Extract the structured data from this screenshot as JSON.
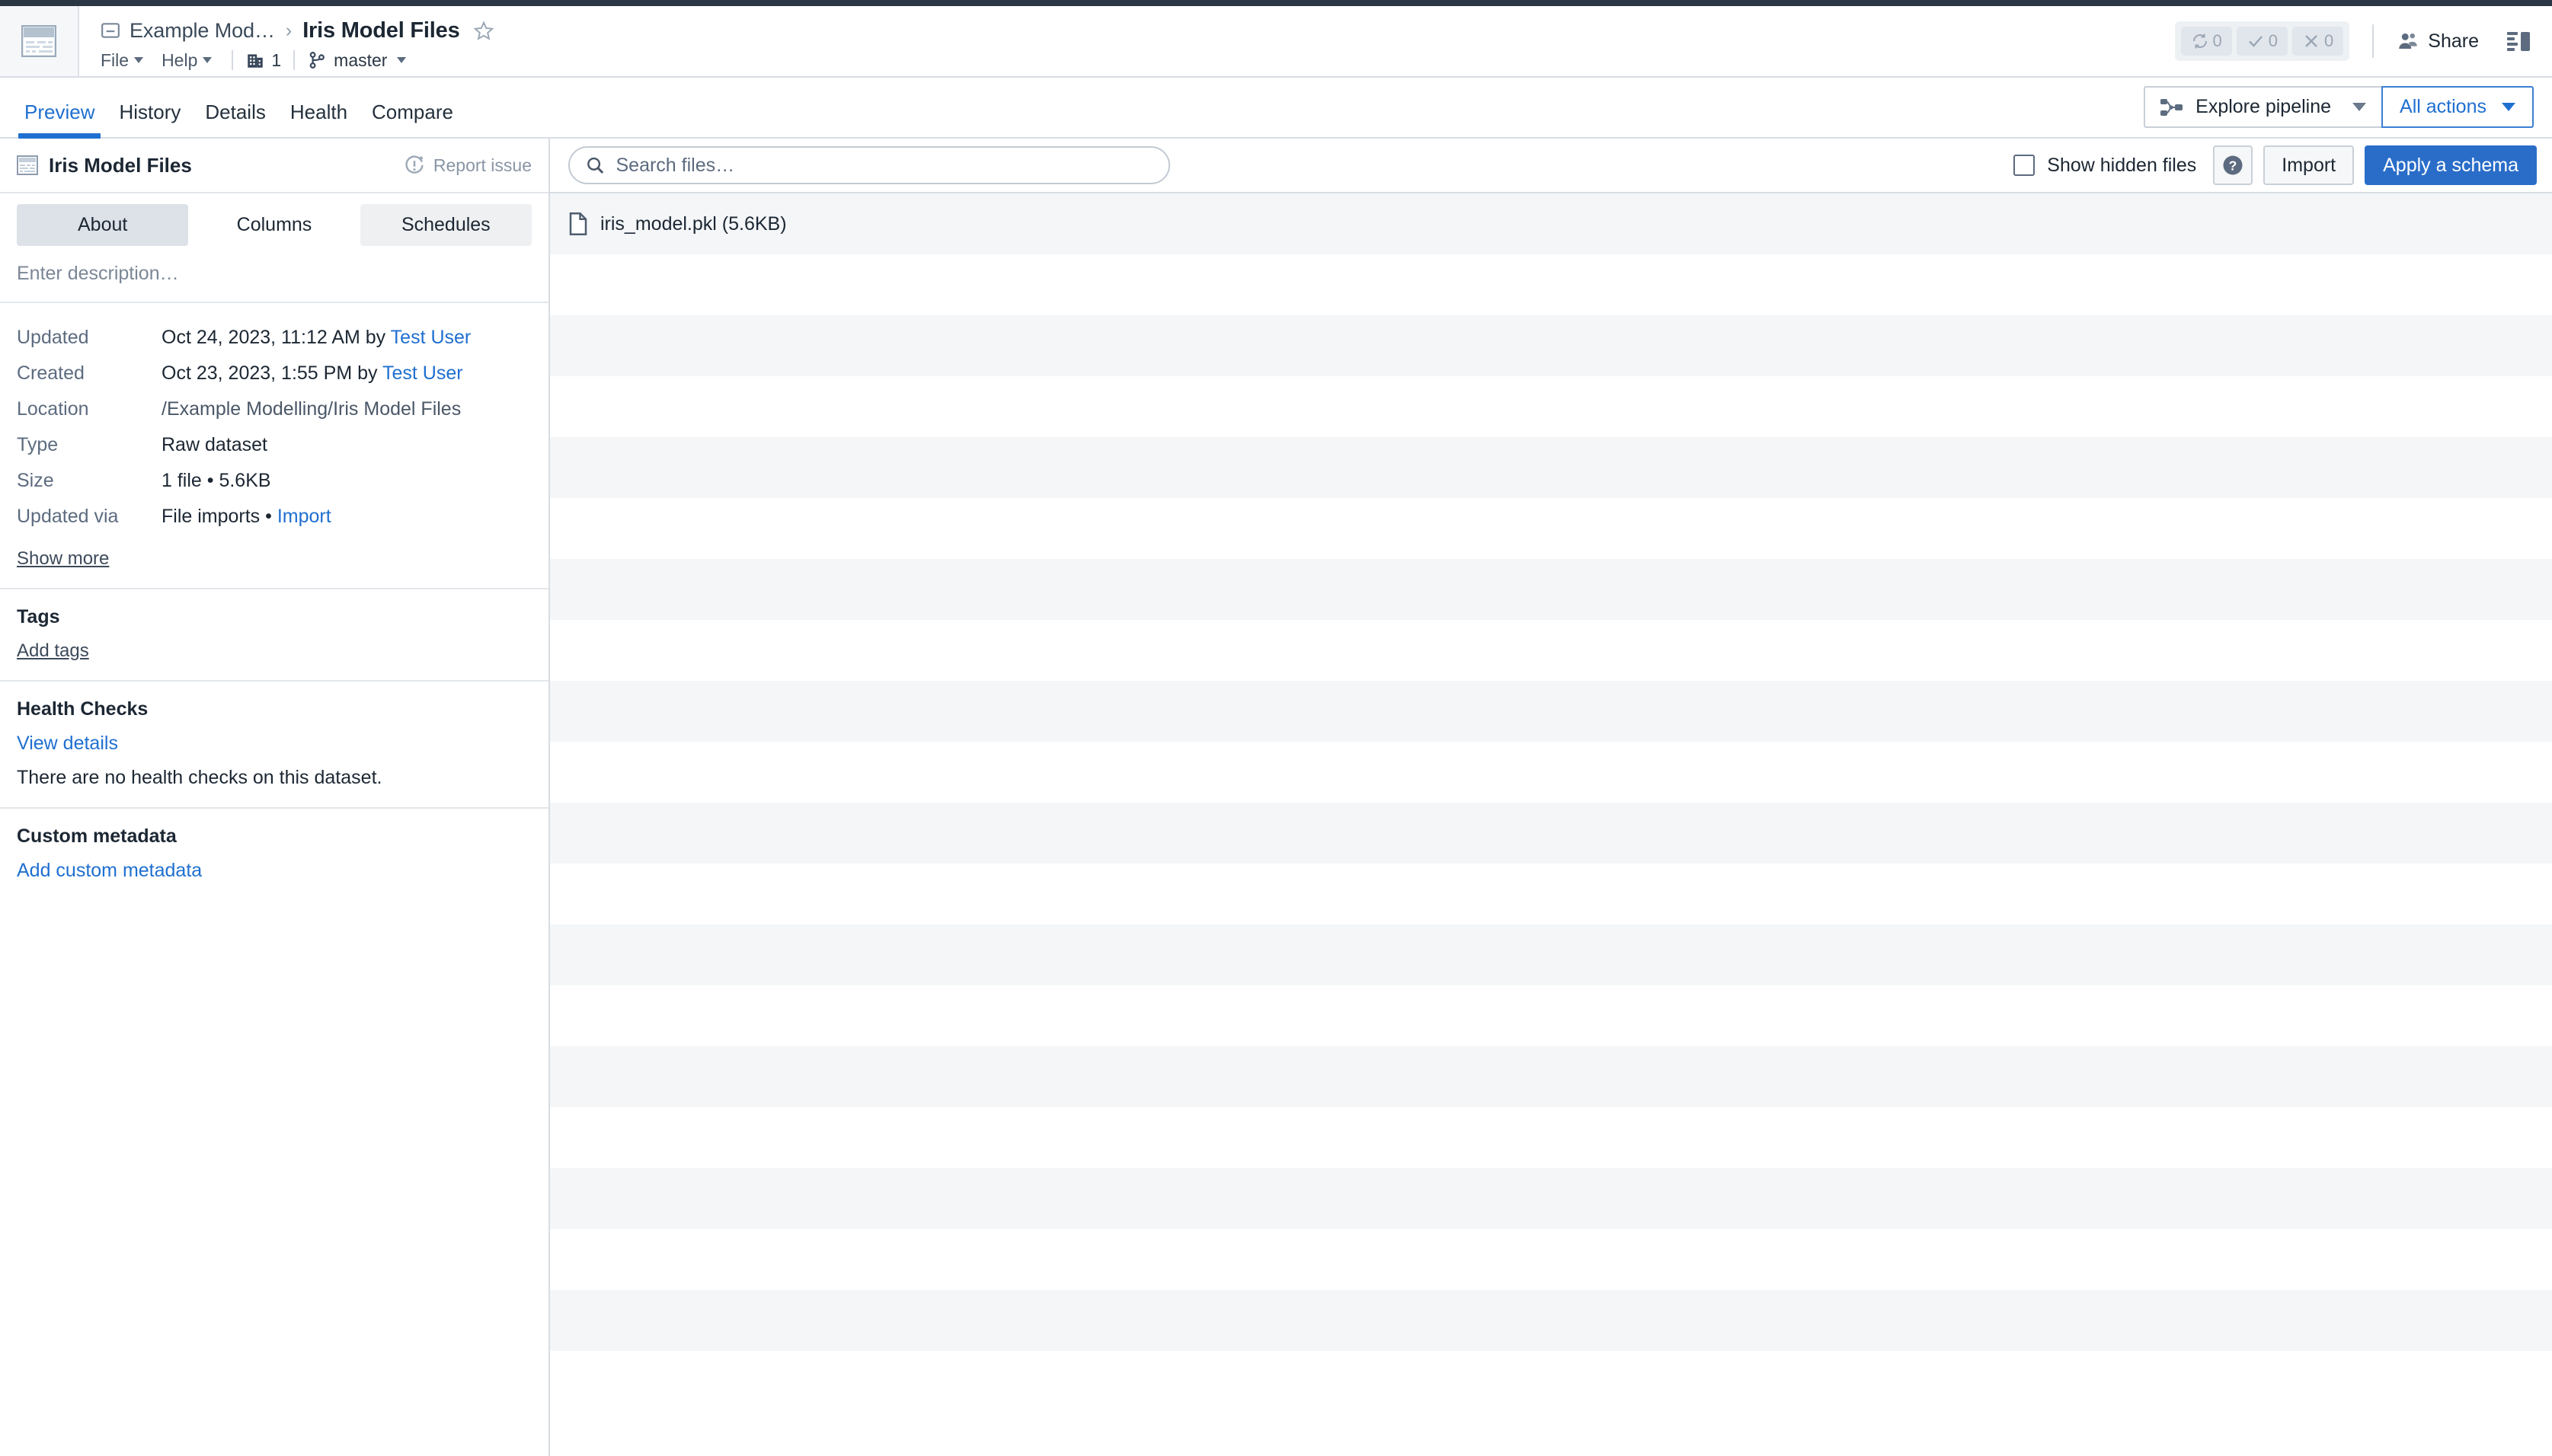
{
  "header": {
    "app_icon": "dataset-icon",
    "breadcrumb": {
      "parent_icon": "folder-icon",
      "parent": "Example Mod…",
      "separator": "›",
      "current": "Iris Model Files",
      "favorite_icon": "star-icon"
    },
    "menus": [
      {
        "label": "File",
        "icon": "chevron-down-icon"
      },
      {
        "label": "Help",
        "icon": "chevron-down-icon"
      }
    ],
    "org_count": "1",
    "org_icon": "organization-icon",
    "branch": "master",
    "branch_icon": "branch-icon",
    "status": {
      "builds_icon": "sync-icon",
      "builds_count": "0",
      "success_icon": "check-icon",
      "success_count": "0",
      "failed_icon": "cross-icon",
      "failed_count": "0"
    },
    "share_label": "Share",
    "share_icon": "people-icon",
    "layout_icon": "panel-layout-icon"
  },
  "tabs": [
    {
      "label": "Preview",
      "active": true
    },
    {
      "label": "History",
      "active": false
    },
    {
      "label": "Details",
      "active": false
    },
    {
      "label": "Health",
      "active": false
    },
    {
      "label": "Compare",
      "active": false
    }
  ],
  "tab_actions": {
    "explore_pipeline": "Explore pipeline",
    "explore_icon": "pipeline-icon",
    "all_actions": "All actions"
  },
  "sidebar": {
    "title": "Iris Model Files",
    "title_icon": "dataset-icon",
    "report_issue": "Report issue",
    "report_icon": "alert-circle-icon",
    "segments": [
      {
        "label": "About",
        "state": "active"
      },
      {
        "label": "Columns",
        "state": "default"
      },
      {
        "label": "Schedules",
        "state": "alt"
      }
    ],
    "description_placeholder": "Enter description…",
    "metadata": [
      {
        "key": "Updated",
        "value": "Oct 24, 2023, 11:12 AM by ",
        "link": "Test User"
      },
      {
        "key": "Created",
        "value": "Oct 23, 2023, 1:55 PM by ",
        "link": "Test User"
      },
      {
        "key": "Location",
        "value": "/Example Modelling/Iris Model Files",
        "link": ""
      },
      {
        "key": "Type",
        "value": "Raw dataset",
        "link": ""
      },
      {
        "key": "Size",
        "value": "1 file • 5.6KB",
        "link": ""
      },
      {
        "key": "Updated via",
        "value": "File imports • ",
        "link": "Import"
      }
    ],
    "show_more": "Show more",
    "tags": {
      "heading": "Tags",
      "add_label": "Add tags"
    },
    "health": {
      "heading": "Health Checks",
      "view_details": "View details",
      "empty_message": "There are no health checks on this dataset."
    },
    "custom_metadata": {
      "heading": "Custom metadata",
      "add_label": "Add custom metadata"
    }
  },
  "content": {
    "search_placeholder": "Search files…",
    "search_value": "",
    "search_icon": "search-icon",
    "show_hidden_label": "Show hidden files",
    "show_hidden_checked": false,
    "help_icon": "help-icon",
    "import_label": "Import",
    "apply_schema_label": "Apply a schema",
    "files": [
      {
        "name": "iris_model.pkl (5.6KB)",
        "icon": "file-icon"
      }
    ],
    "empty_row_count": 19
  },
  "colors": {
    "accent": "#1f6fd0",
    "primary_button": "#2a6dc9",
    "stripe": "#f4f6f8",
    "border": "#d8dde3",
    "muted_text": "#5c6b7f"
  }
}
